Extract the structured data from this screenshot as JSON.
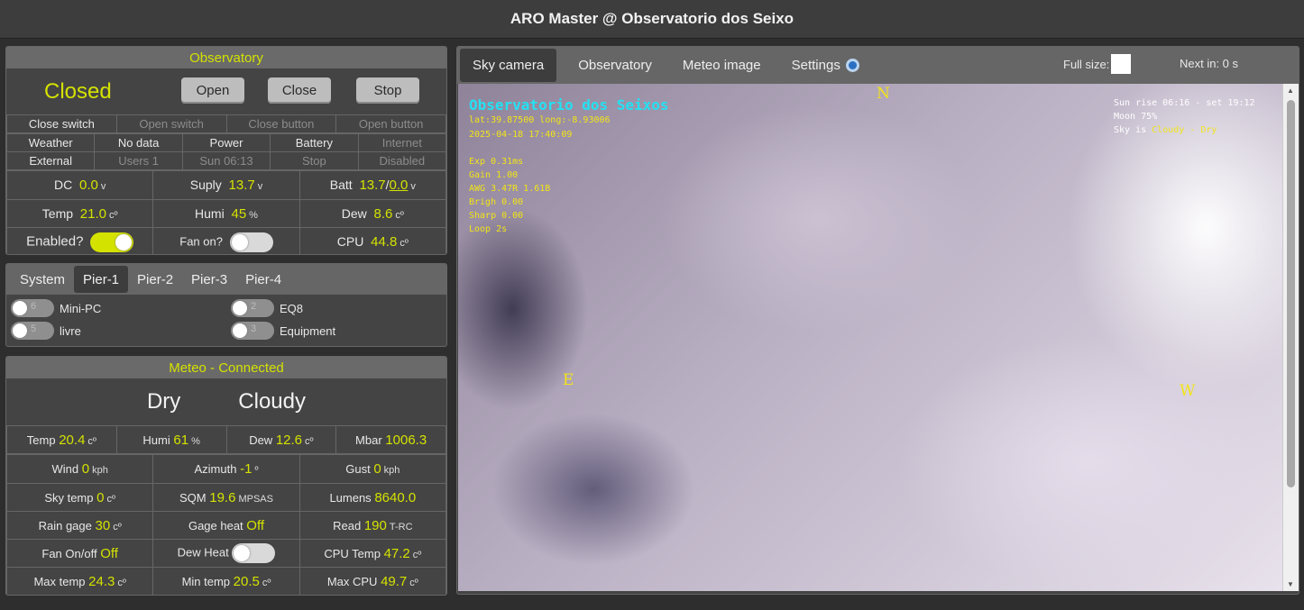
{
  "title": "ARO Master @ Observatorio dos Seixo",
  "observatory": {
    "header": "Observatory",
    "status": "Closed",
    "buttons": {
      "open": "Open",
      "close": "Close",
      "stop": "Stop"
    },
    "switches": [
      "Close switch",
      "Open switch",
      "Close button",
      "Open button"
    ],
    "status_row1": [
      "Weather",
      "No data",
      "Power",
      "Battery",
      "Internet"
    ],
    "status_row2": [
      "External",
      "Users 1",
      "Sun 06:13",
      "Stop",
      "Disabled"
    ],
    "dc": {
      "label": "DC",
      "value": "0.0",
      "unit": "v"
    },
    "supply": {
      "label": "Suply",
      "value": "13.7",
      "unit": "v"
    },
    "batt": {
      "label": "Batt",
      "value": "13.7",
      "value2": "0.0",
      "unit": "v"
    },
    "temp": {
      "label": "Temp",
      "value": "21.0",
      "unit": "cº"
    },
    "humi": {
      "label": "Humi",
      "value": "45",
      "unit": "%"
    },
    "dew": {
      "label": "Dew",
      "value": "8.6",
      "unit": "cº"
    },
    "enabled_label": "Enabled?",
    "enabled_state": true,
    "fan_label": "Fan on?",
    "fan_state": false,
    "cpu": {
      "label": "CPU",
      "value": "44.8",
      "unit": "cº"
    }
  },
  "pier": {
    "tabs": [
      "System",
      "Pier-1",
      "Pier-2",
      "Pier-3",
      "Pier-4"
    ],
    "active_tab": "Pier-1",
    "items": [
      {
        "num": "6",
        "label": "Mini-PC"
      },
      {
        "num": "2",
        "label": "EQ8"
      },
      {
        "num": "5",
        "label": "livre"
      },
      {
        "num": "3",
        "label": "Equipment"
      }
    ]
  },
  "meteo": {
    "header": "Meteo - Connected",
    "state1": "Dry",
    "state2": "Cloudy",
    "temp": {
      "label": "Temp",
      "value": "20.4",
      "unit": "cº"
    },
    "humi": {
      "label": "Humi",
      "value": "61",
      "unit": "%"
    },
    "dew": {
      "label": "Dew",
      "value": "12.6",
      "unit": "cº"
    },
    "mbar": {
      "label": "Mbar",
      "value": "1006.3"
    },
    "wind": {
      "label": "Wind",
      "value": "0",
      "unit": "kph"
    },
    "azimuth": {
      "label": "Azimuth",
      "value": "-1",
      "unit": "º"
    },
    "gust": {
      "label": "Gust",
      "value": "0",
      "unit": "kph"
    },
    "skytemp": {
      "label": "Sky temp",
      "value": "0",
      "unit": "cº"
    },
    "sqm": {
      "label": "SQM",
      "value": "19.6",
      "unit": "MPSAS"
    },
    "lumens": {
      "label": "Lumens",
      "value": "8640.0"
    },
    "raingage": {
      "label": "Rain gage",
      "value": "30",
      "unit": "cº"
    },
    "gageheat": {
      "label": "Gage heat",
      "value": "Off"
    },
    "read": {
      "label": "Read",
      "value": "190",
      "unit": "T-RC"
    },
    "fanonoff": {
      "label": "Fan On/off",
      "value": "Off"
    },
    "dewheat": {
      "label": "Dew Heat",
      "state": false
    },
    "cputemp": {
      "label": "CPU Temp",
      "value": "47.2",
      "unit": "cº"
    },
    "maxtemp": {
      "label": "Max temp",
      "value": "24.3",
      "unit": "cº"
    },
    "mintemp": {
      "label": "Min temp",
      "value": "20.5",
      "unit": "cº"
    },
    "maxcpu": {
      "label": "Max CPU",
      "value": "49.7",
      "unit": "cº"
    }
  },
  "camera": {
    "tabs": [
      "Sky camera",
      "Observatory",
      "Meteo image",
      "Settings"
    ],
    "active_tab": "Sky camera",
    "fullsize_label": "Full size:",
    "next_in": "Next in: 0 s",
    "overlay": {
      "name": "Observatorio dos Seixos",
      "coords": "lat:39.87500 long:-8.93006",
      "datetime": "2025-04-18 17:40:09",
      "exp": "Exp 0.31ms",
      "gain": "Gain 1.00",
      "awg": "AWG 3.47R 1.61B",
      "brigh": "Brigh 0.00",
      "sharp": "Sharp 0.00",
      "loop": "Loop 2s",
      "sun": "Sun rise 06:16 - set 19:12",
      "moon": "Moon 75%",
      "sky_prefix": "Sky is",
      "sky_value": "Cloudy - Dry"
    },
    "cardinals": {
      "n": "N",
      "e": "E",
      "w": "W"
    }
  },
  "colors": {
    "accent": "#d4e200",
    "panel": "#444444",
    "header": "#6a6a6a"
  }
}
